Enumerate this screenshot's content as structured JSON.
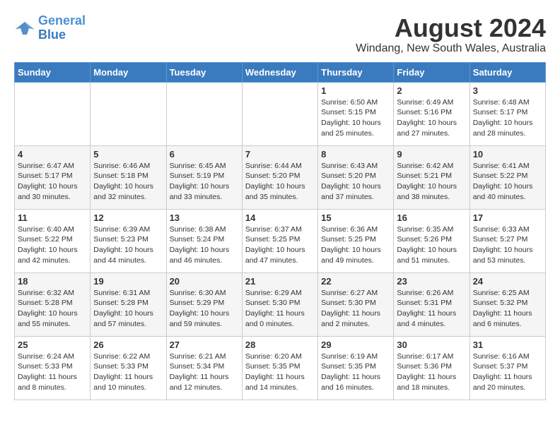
{
  "header": {
    "logo_line1": "General",
    "logo_line2": "Blue",
    "month_title": "August 2024",
    "location": "Windang, New South Wales, Australia"
  },
  "days_of_week": [
    "Sunday",
    "Monday",
    "Tuesday",
    "Wednesday",
    "Thursday",
    "Friday",
    "Saturday"
  ],
  "weeks": [
    [
      {
        "day": "",
        "info": ""
      },
      {
        "day": "",
        "info": ""
      },
      {
        "day": "",
        "info": ""
      },
      {
        "day": "",
        "info": ""
      },
      {
        "day": "1",
        "info": "Sunrise: 6:50 AM\nSunset: 5:15 PM\nDaylight: 10 hours\nand 25 minutes."
      },
      {
        "day": "2",
        "info": "Sunrise: 6:49 AM\nSunset: 5:16 PM\nDaylight: 10 hours\nand 27 minutes."
      },
      {
        "day": "3",
        "info": "Sunrise: 6:48 AM\nSunset: 5:17 PM\nDaylight: 10 hours\nand 28 minutes."
      }
    ],
    [
      {
        "day": "4",
        "info": "Sunrise: 6:47 AM\nSunset: 5:17 PM\nDaylight: 10 hours\nand 30 minutes."
      },
      {
        "day": "5",
        "info": "Sunrise: 6:46 AM\nSunset: 5:18 PM\nDaylight: 10 hours\nand 32 minutes."
      },
      {
        "day": "6",
        "info": "Sunrise: 6:45 AM\nSunset: 5:19 PM\nDaylight: 10 hours\nand 33 minutes."
      },
      {
        "day": "7",
        "info": "Sunrise: 6:44 AM\nSunset: 5:20 PM\nDaylight: 10 hours\nand 35 minutes."
      },
      {
        "day": "8",
        "info": "Sunrise: 6:43 AM\nSunset: 5:20 PM\nDaylight: 10 hours\nand 37 minutes."
      },
      {
        "day": "9",
        "info": "Sunrise: 6:42 AM\nSunset: 5:21 PM\nDaylight: 10 hours\nand 38 minutes."
      },
      {
        "day": "10",
        "info": "Sunrise: 6:41 AM\nSunset: 5:22 PM\nDaylight: 10 hours\nand 40 minutes."
      }
    ],
    [
      {
        "day": "11",
        "info": "Sunrise: 6:40 AM\nSunset: 5:22 PM\nDaylight: 10 hours\nand 42 minutes."
      },
      {
        "day": "12",
        "info": "Sunrise: 6:39 AM\nSunset: 5:23 PM\nDaylight: 10 hours\nand 44 minutes."
      },
      {
        "day": "13",
        "info": "Sunrise: 6:38 AM\nSunset: 5:24 PM\nDaylight: 10 hours\nand 46 minutes."
      },
      {
        "day": "14",
        "info": "Sunrise: 6:37 AM\nSunset: 5:25 PM\nDaylight: 10 hours\nand 47 minutes."
      },
      {
        "day": "15",
        "info": "Sunrise: 6:36 AM\nSunset: 5:25 PM\nDaylight: 10 hours\nand 49 minutes."
      },
      {
        "day": "16",
        "info": "Sunrise: 6:35 AM\nSunset: 5:26 PM\nDaylight: 10 hours\nand 51 minutes."
      },
      {
        "day": "17",
        "info": "Sunrise: 6:33 AM\nSunset: 5:27 PM\nDaylight: 10 hours\nand 53 minutes."
      }
    ],
    [
      {
        "day": "18",
        "info": "Sunrise: 6:32 AM\nSunset: 5:28 PM\nDaylight: 10 hours\nand 55 minutes."
      },
      {
        "day": "19",
        "info": "Sunrise: 6:31 AM\nSunset: 5:28 PM\nDaylight: 10 hours\nand 57 minutes."
      },
      {
        "day": "20",
        "info": "Sunrise: 6:30 AM\nSunset: 5:29 PM\nDaylight: 10 hours\nand 59 minutes."
      },
      {
        "day": "21",
        "info": "Sunrise: 6:29 AM\nSunset: 5:30 PM\nDaylight: 11 hours\nand 0 minutes."
      },
      {
        "day": "22",
        "info": "Sunrise: 6:27 AM\nSunset: 5:30 PM\nDaylight: 11 hours\nand 2 minutes."
      },
      {
        "day": "23",
        "info": "Sunrise: 6:26 AM\nSunset: 5:31 PM\nDaylight: 11 hours\nand 4 minutes."
      },
      {
        "day": "24",
        "info": "Sunrise: 6:25 AM\nSunset: 5:32 PM\nDaylight: 11 hours\nand 6 minutes."
      }
    ],
    [
      {
        "day": "25",
        "info": "Sunrise: 6:24 AM\nSunset: 5:33 PM\nDaylight: 11 hours\nand 8 minutes."
      },
      {
        "day": "26",
        "info": "Sunrise: 6:22 AM\nSunset: 5:33 PM\nDaylight: 11 hours\nand 10 minutes."
      },
      {
        "day": "27",
        "info": "Sunrise: 6:21 AM\nSunset: 5:34 PM\nDaylight: 11 hours\nand 12 minutes."
      },
      {
        "day": "28",
        "info": "Sunrise: 6:20 AM\nSunset: 5:35 PM\nDaylight: 11 hours\nand 14 minutes."
      },
      {
        "day": "29",
        "info": "Sunrise: 6:19 AM\nSunset: 5:35 PM\nDaylight: 11 hours\nand 16 minutes."
      },
      {
        "day": "30",
        "info": "Sunrise: 6:17 AM\nSunset: 5:36 PM\nDaylight: 11 hours\nand 18 minutes."
      },
      {
        "day": "31",
        "info": "Sunrise: 6:16 AM\nSunset: 5:37 PM\nDaylight: 11 hours\nand 20 minutes."
      }
    ]
  ]
}
